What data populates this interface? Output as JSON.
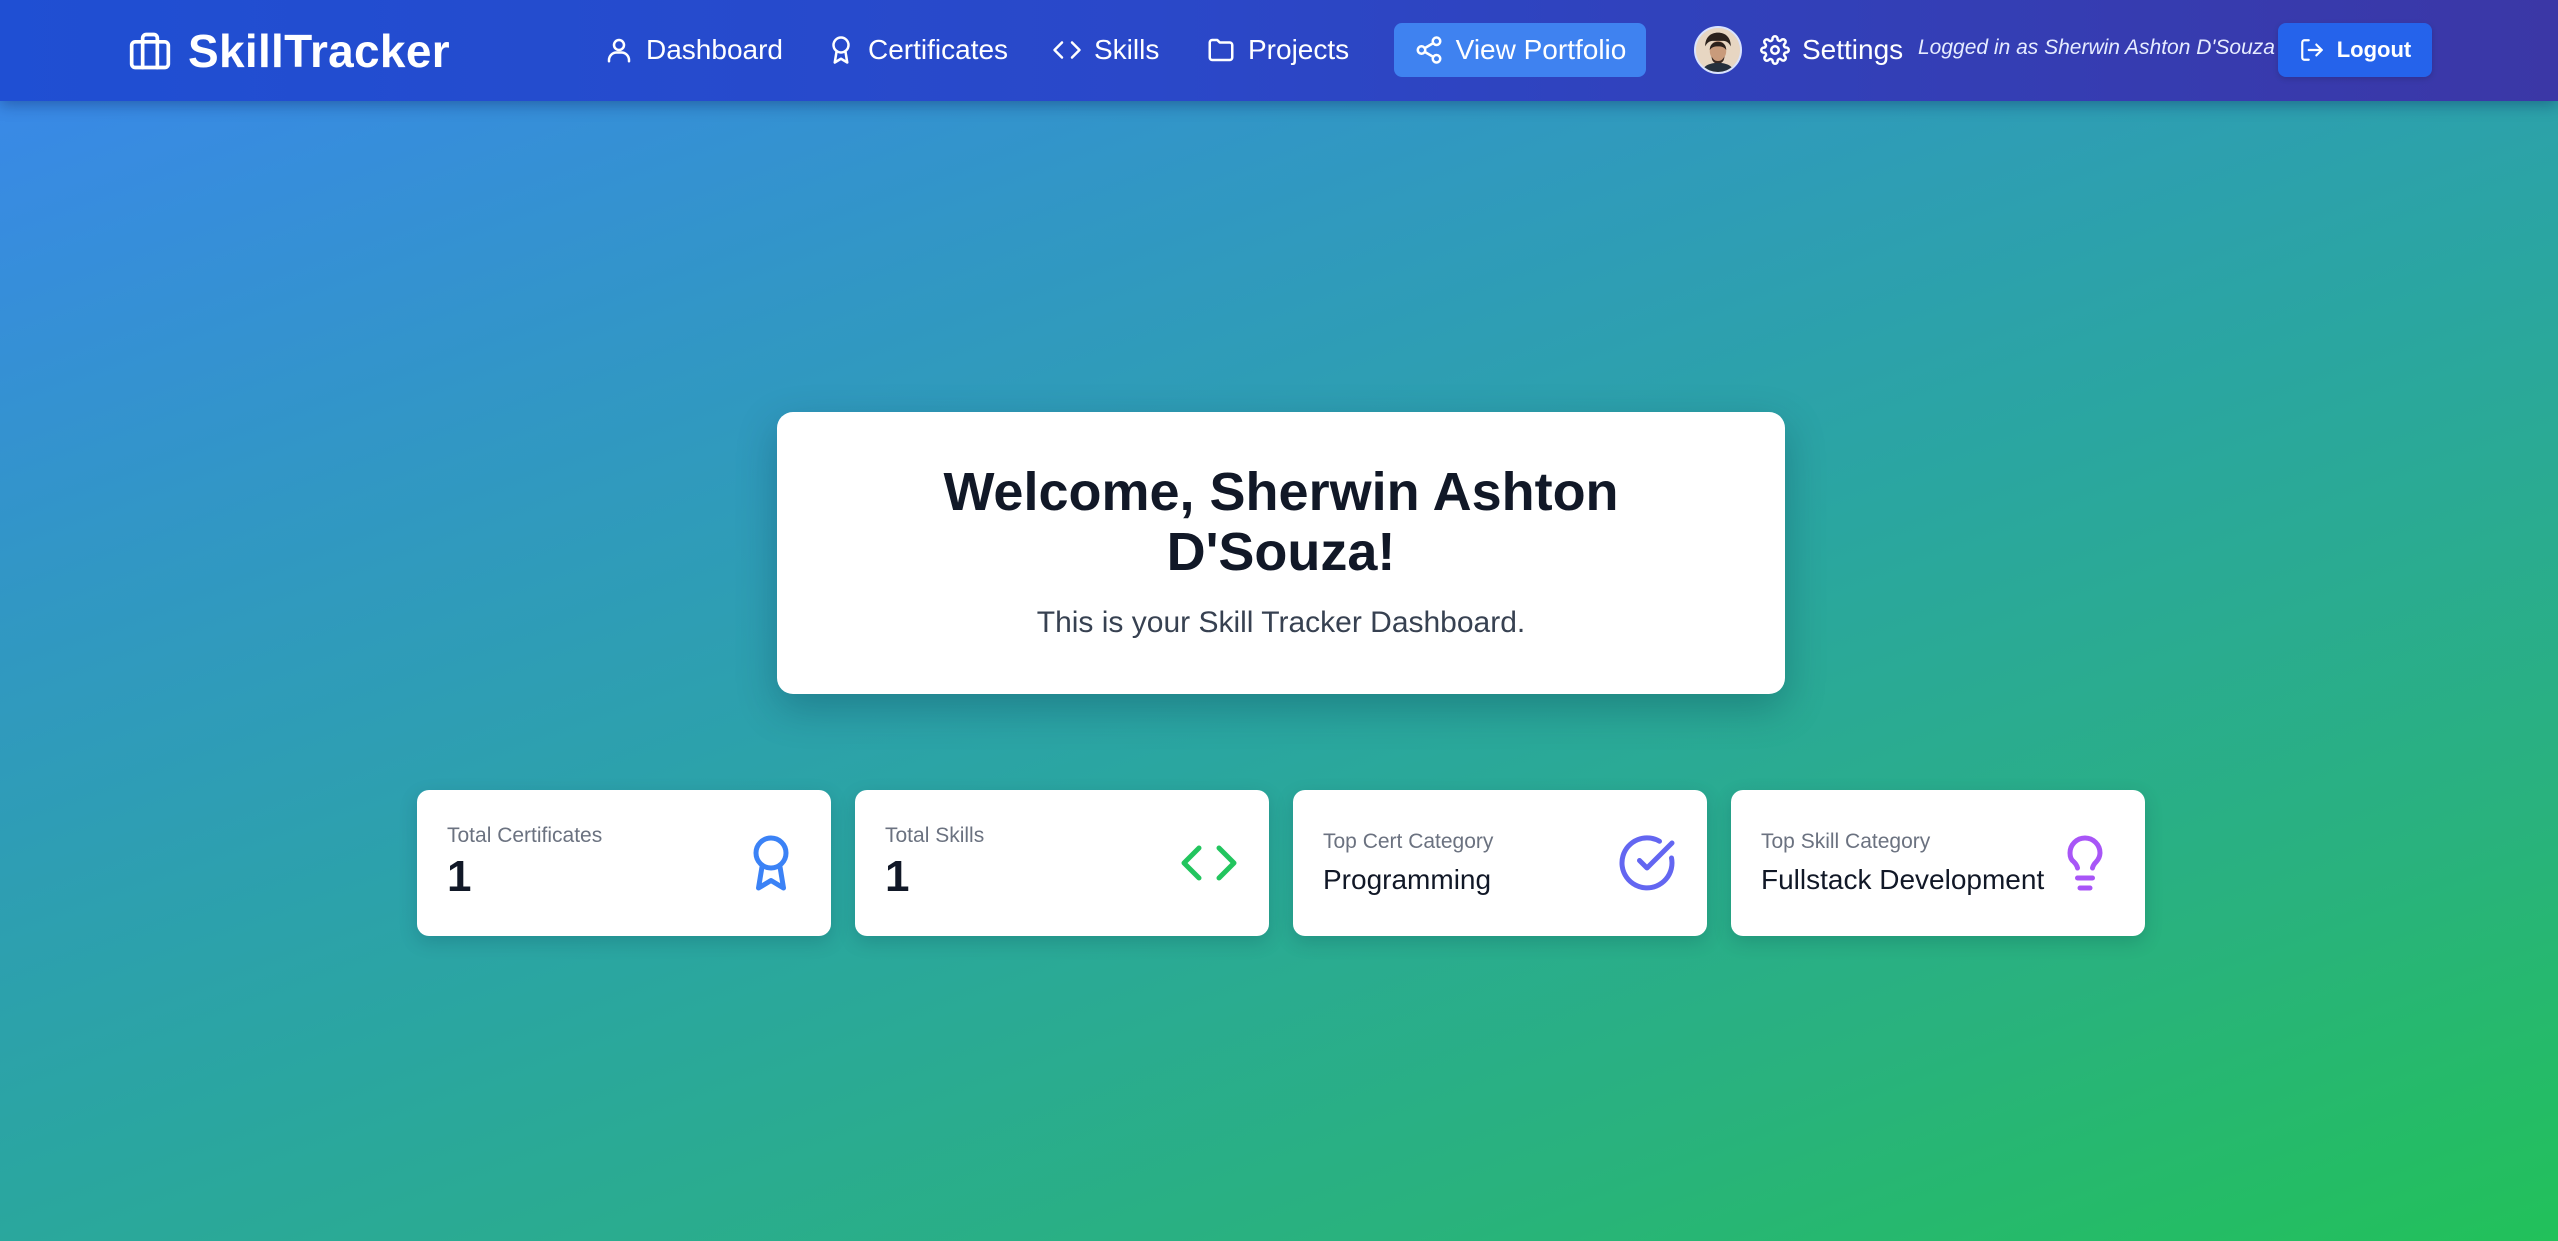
{
  "navbar": {
    "brand": "SkillTracker",
    "items": [
      {
        "label": "Dashboard",
        "icon": "user-icon"
      },
      {
        "label": "Certificates",
        "icon": "award-icon"
      },
      {
        "label": "Skills",
        "icon": "code-icon"
      },
      {
        "label": "Projects",
        "icon": "folder-icon"
      }
    ],
    "portfolio_label": "View Portfolio",
    "settings_label": "Settings",
    "logged_in_text": "Logged in as Sherwin Ashton D'Souza",
    "logout_label": "Logout"
  },
  "welcome": {
    "title": "Welcome, Sherwin Ashton D'Souza!",
    "subtitle": "This is your Skill Tracker Dashboard."
  },
  "stats": [
    {
      "label": "Total Certificates",
      "value": "1",
      "icon": "award-icon",
      "color": "#3b82f6"
    },
    {
      "label": "Total Skills",
      "value": "1",
      "icon": "code-icon",
      "color": "#22c55e"
    },
    {
      "label": "Top Cert Category",
      "value": "Programming",
      "icon": "check-circle-icon",
      "color": "#6366f1"
    },
    {
      "label": "Top Skill Category",
      "value": "Fullstack Development",
      "icon": "lightbulb-icon",
      "color": "#a855f7"
    }
  ],
  "colors": {
    "navbar_start": "#1f4fd3",
    "navbar_end": "#3b37a6",
    "portfolio_button": "#3f82f0",
    "logout_button": "#2563eb",
    "background_start": "#3b86ee",
    "background_end": "#22c15a"
  }
}
